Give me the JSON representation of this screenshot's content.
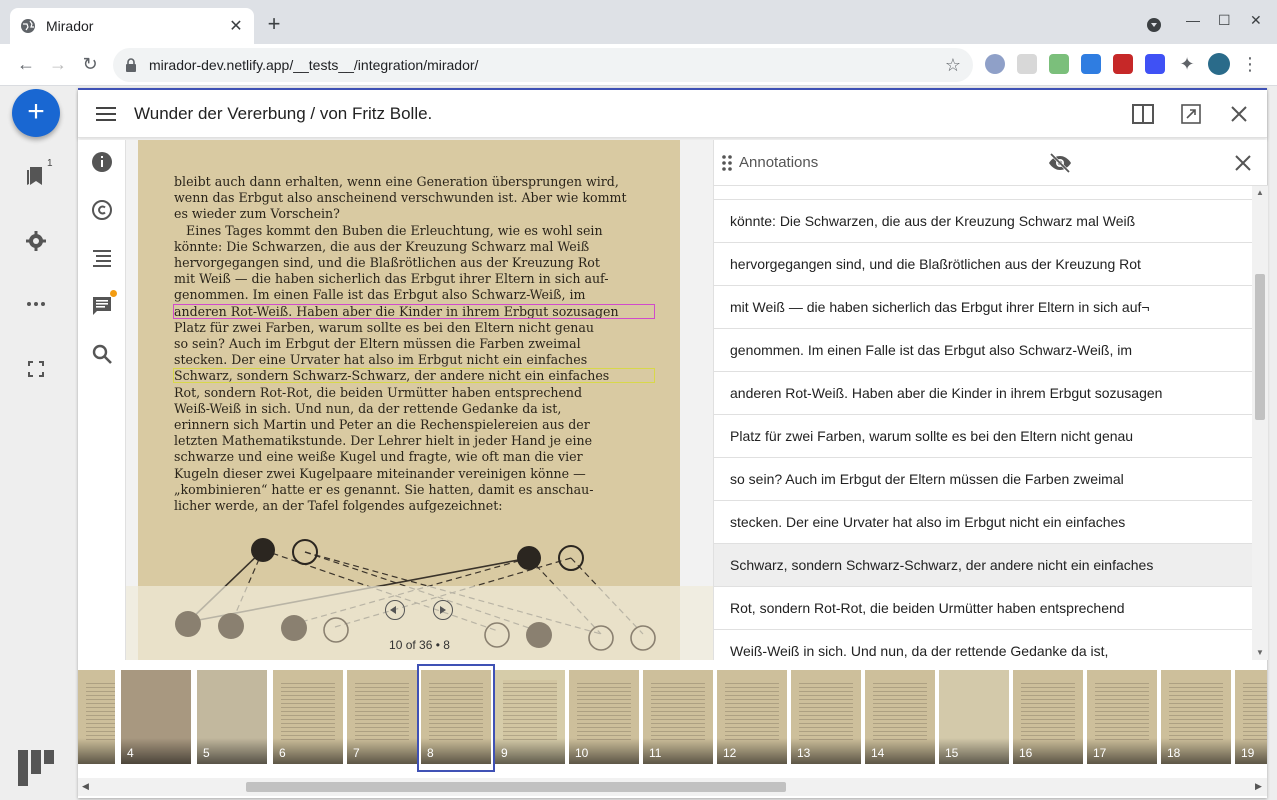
{
  "browser": {
    "tab_title": "Mirador",
    "url": "mirador-dev.netlify.app/__tests__/integration/mirador/"
  },
  "leftbar": {
    "catalog_badge": "1"
  },
  "window": {
    "title": "Wunder der Vererbung / von Fritz Bolle."
  },
  "page_text": [
    "bleibt auch dann erhalten, wenn eine Generation übersprungen wird,",
    "wenn das Erbgut also anscheinend verschwunden ist. Aber wie kommt",
    "es wieder zum Vorschein?",
    "Eines Tages kommt den Buben die Erleuchtung, wie es wohl sein",
    "könnte: Die Schwarzen, die aus der Kreuzung Schwarz mal Weiß",
    "hervorgegangen sind, und die Blaßrötlichen aus der Kreuzung Rot",
    "mit Weiß — die haben sicherlich das Erbgut ihrer Eltern in sich auf-",
    "genommen. Im einen Falle ist das Erbgut also Schwarz-Weiß, im",
    "anderen Rot-Weiß. Haben aber die Kinder in ihrem Erbgut sozusagen",
    "Platz für zwei Farben, warum sollte es bei den Eltern nicht genau",
    "so sein? Auch im Erbgut der Eltern müssen die Farben zweimal",
    "stecken. Der eine Urvater hat also im Erbgut nicht ein einfaches",
    "Schwarz, sondern Schwarz-Schwarz, der andere nicht ein einfaches",
    "Rot, sondern Rot-Rot, die beiden Urmütter haben entsprechend",
    "Weiß-Weiß in sich. Und nun, da der rettende Gedanke da ist,",
    "erinnern sich Martin und Peter an die Rechenspielereien aus der",
    "letzten Mathematikstunde. Der Lehrer hielt in jeder Hand je eine",
    "schwarze und eine weiße Kugel und fragte, wie oft man die vier",
    "Kugeln dieser zwei Kugelpaare miteinander vereinigen könne —",
    "„kombinieren“ hatte er es genannt. Sie hatten, damit es anschau-",
    "licher werde, an der Tafel folgendes aufgezeichnet:"
  ],
  "viewer": {
    "page_label": "10 of 36 • 8"
  },
  "annotations": {
    "title": "Annotations",
    "items": [
      "könnte: Die Schwarzen, die aus der Kreuzung Schwarz mal Weiß",
      "hervorgegangen sind, und die Blaßrötlichen aus der Kreuzung Rot",
      "mit Weiß — die haben sicherlich das Erbgut ihrer Eltern in sich auf¬",
      "genommen. Im einen Falle ist das Erbgut also Schwarz-Weiß, im",
      "anderen Rot-Weiß. Haben aber die Kinder in ihrem Erbgut sozusagen",
      "Platz für zwei Farben, warum sollte es bei den Eltern nicht genau",
      "so sein? Auch im Erbgut der Eltern müssen die Farben zweimal",
      "stecken. Der eine Urvater hat also im Erbgut nicht ein einfaches",
      "Schwarz, sondern Schwarz-Schwarz, der andere nicht ein einfaches",
      "Rot, sondern Rot-Rot, die beiden Urmütter haben entsprechend",
      "Weiß-Weiß in sich. Und nun, da der rettende Gedanke da ist,"
    ]
  },
  "thumbnails": [
    "",
    "4",
    "5",
    "6",
    "7",
    "8",
    "9",
    "10",
    "11",
    "12",
    "13",
    "14",
    "15",
    "16",
    "17",
    "18",
    "19"
  ],
  "colors": {
    "accent": "#3f51b5",
    "fab": "#1967d2",
    "highlight_magenta": "#d14bcb",
    "highlight_yellow": "#d8d84a"
  }
}
